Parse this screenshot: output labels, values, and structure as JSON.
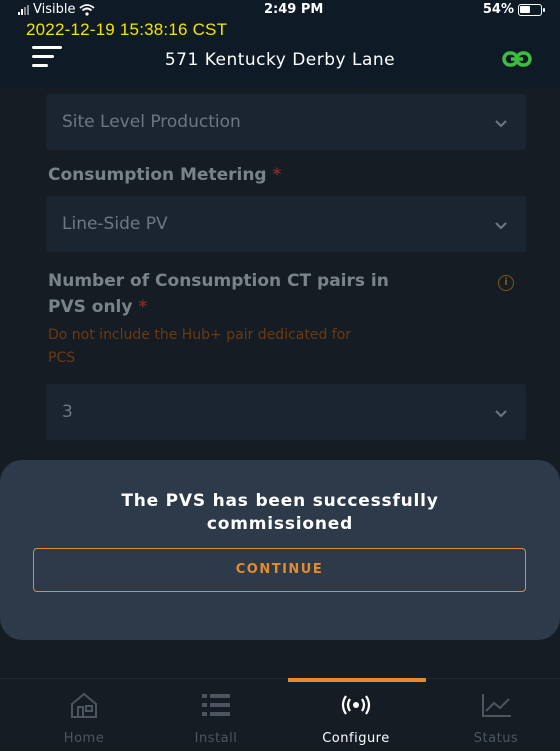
{
  "status_bar": {
    "carrier": "Visible",
    "time": "2:49 PM",
    "battery": "54%",
    "battery_level": 0.54,
    "timestamp_overlay": "2022-12-19 15:38:16 CST"
  },
  "header": {
    "title": "571 Kentucky Derby Lane",
    "menu_icon": "hamburger-icon",
    "link_icon": "link-icon",
    "accent": "#3dbd3d"
  },
  "form": {
    "production_select": {
      "value": "Site Level Production"
    },
    "consumption_metering": {
      "label": "Consumption Metering",
      "required_marker": "*",
      "value": "Line-Side PV"
    },
    "ct_pairs": {
      "label_line1": "Number of Consumption CT pairs in",
      "label_line2": "PVS only",
      "required_marker": "*",
      "hint_line1": "Do not include the Hub+ pair dedicated for",
      "hint_line2": "PCS",
      "value": "3",
      "info_icon": "info-icon"
    }
  },
  "dialog": {
    "message_line1": "The PVS has been successfully",
    "message_line2": "commissioned",
    "continue_label": "CONTINUE",
    "accent": "#e58b2e"
  },
  "tabbar": {
    "tabs": [
      {
        "label": "Home",
        "icon": "home-icon"
      },
      {
        "label": "Install",
        "icon": "list-icon"
      },
      {
        "label": "Configure",
        "icon": "broadcast-icon",
        "active": true
      },
      {
        "label": "Status",
        "icon": "chart-icon"
      }
    ]
  }
}
